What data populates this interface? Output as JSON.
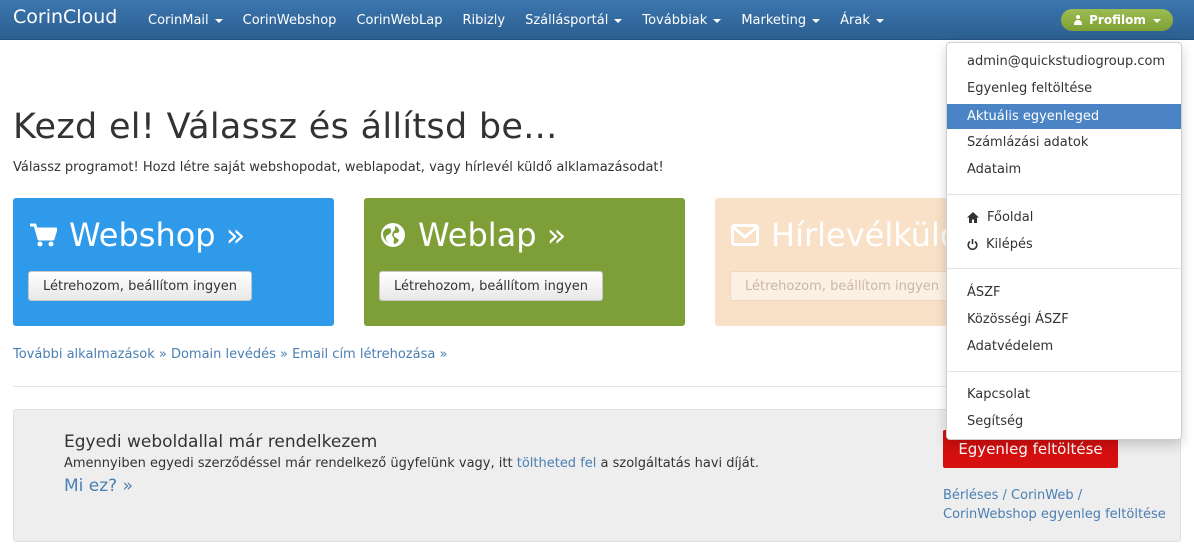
{
  "navbar": {
    "brand": "CorinCloud",
    "items": [
      {
        "label": "CorinMail",
        "dropdown": true
      },
      {
        "label": "CorinWebshop",
        "dropdown": false
      },
      {
        "label": "CorinWebLap",
        "dropdown": false
      },
      {
        "label": "Ribizly",
        "dropdown": false
      },
      {
        "label": "Szállásportál",
        "dropdown": true
      },
      {
        "label": "Továbbiak",
        "dropdown": true
      },
      {
        "label": "Marketing",
        "dropdown": true
      },
      {
        "label": "Árak",
        "dropdown": true
      }
    ],
    "profile_label": "Profilom"
  },
  "hero": {
    "title": "Kezd el! Válassz és állítsd be...",
    "subtitle": "Válassz programot! Hozd létre saját webshopodat, weblapodat, vagy hírlevél küldő alklamazásodat!"
  },
  "cards": [
    {
      "title": "Webshop »",
      "icon": "cart-icon",
      "button": "Létrehozom, beállítom ingyen",
      "color": "#2f9aea"
    },
    {
      "title": "Weblap »",
      "icon": "globe-icon",
      "button": "Létrehozom, beállítom ingyen",
      "color": "#7e9f38"
    },
    {
      "title": "Hírlevélküldő",
      "icon": "envelope-icon",
      "button": "Létrehozom, beállítom ingyen",
      "color": "#f9e1c8"
    }
  ],
  "links": {
    "more_apps": "További alkalmazások »",
    "domain": "Domain levédés »",
    "email": "Email cím létrehozása »"
  },
  "panel": {
    "title": "Egyedi weboldallal már rendelkezem",
    "text_before": "Amennyiben egyedi szerződéssel már rendelkező ügyfelünk vagy, itt ",
    "text_link": "töltheted fel",
    "text_after": " a szolgáltatás havi díját.",
    "more": "Mi ez? »",
    "topup_button": "Egyenleg feltöltése",
    "side_link_line1": "Bérléses / CorinWeb /",
    "side_link_line2": "CorinWebshop egyenleg feltöltése"
  },
  "dropdown": {
    "group1": [
      "admin@quickstudiogroup.com",
      "Egyenleg feltöltése",
      "Aktuális egyenleged",
      "Számlázási adatok",
      "Adataim"
    ],
    "active_item": "Aktuális egyenleged",
    "group2": [
      {
        "label": "Főoldal",
        "icon": "home-icon"
      },
      {
        "label": "Kilépés",
        "icon": "power-icon"
      }
    ],
    "group3": [
      "ÁSZF",
      "Közösségi ÁSZF",
      "Adatvédelem"
    ],
    "group4": [
      "Kapcsolat",
      "Segítség"
    ]
  },
  "colors": {
    "navbar": "#2c5f92",
    "profile": "#7ea033",
    "active": "#4a84c4",
    "topup": "#d60f0f",
    "link": "#4a7fb3"
  }
}
